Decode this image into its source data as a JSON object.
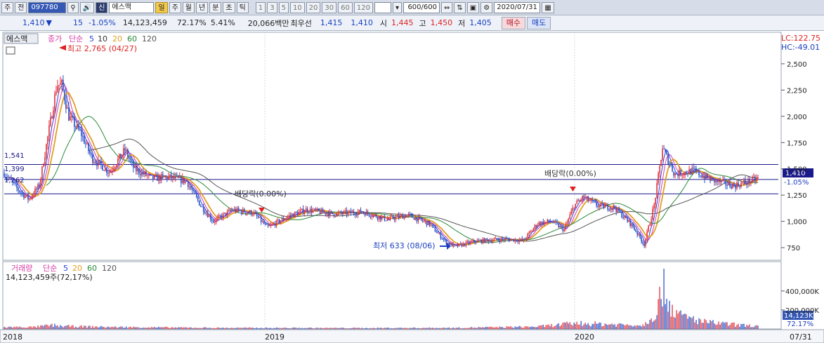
{
  "toolbar": {
    "market": "주",
    "prev": "전",
    "code": "097780",
    "search_icon": "search-icon",
    "speaker_icon": "speaker-icon",
    "name_badge": "신",
    "stock_name": "에스맥",
    "periods": [
      "일",
      "주",
      "월",
      "년",
      "분",
      "초",
      "틱"
    ],
    "active_period": "일",
    "intervals": [
      "1",
      "3",
      "5",
      "10",
      "20",
      "30",
      "60",
      "120"
    ],
    "count": "600",
    "count_total": "/600",
    "date": "2020/07/31"
  },
  "info": {
    "price": "1,410",
    "change_arrow": "▼",
    "change": "15",
    "change_pct": "-1.05%",
    "volume": "14,123,459",
    "volume_ratio": "72.17%",
    "turnover": "5.41%",
    "amount": "20,066백만",
    "bid_label": "최우선",
    "bid": "1,415",
    "ask": "1,410",
    "open_label": "시",
    "open": "1,445",
    "high_label": "고",
    "high": "1,450",
    "low_label": "저",
    "low": "1,405",
    "buy_label": "매수",
    "sell_label": "매도"
  },
  "price_panel": {
    "name": "에스맥",
    "legend": [
      "종가",
      "단순",
      "5",
      "10",
      "20",
      "60",
      "120"
    ],
    "lc": "LC:122.75",
    "hc": "HC:-49.01",
    "max_label": "최고 2,765 (04/27)",
    "min_label": "최저 633 (08/06)",
    "ex_div_1": "배당락(0.00%)",
    "ex_div_2": "배당락(0.00%)",
    "hline_labels": [
      "1,541",
      "1,399",
      "1,262"
    ],
    "last_price": "1,410",
    "last_pct": "-1.05%"
  },
  "volume_panel": {
    "legend": [
      "거래량",
      "단순",
      "5",
      "20",
      "60",
      "120"
    ],
    "current": "14,123,459주(72,17%)",
    "last_tag": "14,123K",
    "last_pct": "72.17%"
  },
  "x_axis": {
    "labels": [
      "2018",
      "2019",
      "2020",
      "07/31"
    ]
  },
  "colors": {
    "up": "#e0323c",
    "down": "#2c52c8",
    "ma5": "#2c3fd6",
    "ma10": "#d63ca6",
    "ma20": "#e0a020",
    "ma60": "#2a8a3a",
    "ma120": "#555555",
    "hline": "#1a1a8a"
  },
  "chart_data": {
    "type": "candlestick",
    "title": "에스맥",
    "x_range": [
      "2018-01",
      "2020-07-31"
    ],
    "price_ylim": [
      630,
      2800
    ],
    "price_ticks": [
      750,
      1000,
      1250,
      1500,
      1750,
      2000,
      2250,
      2500
    ],
    "price_tick_labels": [
      "750",
      "1,000",
      "1,250",
      "1,500",
      "1,750",
      "2,000",
      "2,250",
      "2,500"
    ],
    "volume_ylim": [
      0,
      480000
    ],
    "volume_ticks": [
      200000,
      400000
    ],
    "volume_tick_labels": [
      "200,000K",
      "400,000K"
    ],
    "close_series": [
      {
        "t": 0,
        "v": 1460
      },
      {
        "t": 20,
        "v": 1300
      },
      {
        "t": 35,
        "v": 1210
      },
      {
        "t": 50,
        "v": 1340
      },
      {
        "t": 62,
        "v": 1800
      },
      {
        "t": 75,
        "v": 2300
      },
      {
        "t": 82,
        "v": 2300
      },
      {
        "t": 92,
        "v": 2000
      },
      {
        "t": 110,
        "v": 1830
      },
      {
        "t": 125,
        "v": 1600
      },
      {
        "t": 150,
        "v": 1470
      },
      {
        "t": 172,
        "v": 1680
      },
      {
        "t": 185,
        "v": 1500
      },
      {
        "t": 210,
        "v": 1410
      },
      {
        "t": 235,
        "v": 1420
      },
      {
        "t": 260,
        "v": 1380
      },
      {
        "t": 280,
        "v": 1150
      },
      {
        "t": 298,
        "v": 1000
      },
      {
        "t": 325,
        "v": 1110
      },
      {
        "t": 355,
        "v": 1080
      },
      {
        "t": 375,
        "v": 940
      },
      {
        "t": 405,
        "v": 1050
      },
      {
        "t": 430,
        "v": 1110
      },
      {
        "t": 470,
        "v": 1070
      },
      {
        "t": 510,
        "v": 1090
      },
      {
        "t": 545,
        "v": 1020
      },
      {
        "t": 575,
        "v": 1060
      },
      {
        "t": 605,
        "v": 980
      },
      {
        "t": 630,
        "v": 800
      },
      {
        "t": 642,
        "v": 760
      },
      {
        "t": 670,
        "v": 810
      },
      {
        "t": 710,
        "v": 830
      },
      {
        "t": 740,
        "v": 820
      },
      {
        "t": 760,
        "v": 980
      },
      {
        "t": 780,
        "v": 1000
      },
      {
        "t": 798,
        "v": 920
      },
      {
        "t": 812,
        "v": 1150
      },
      {
        "t": 825,
        "v": 1230
      },
      {
        "t": 845,
        "v": 1150
      },
      {
        "t": 870,
        "v": 1130
      },
      {
        "t": 895,
        "v": 960
      },
      {
        "t": 912,
        "v": 780
      },
      {
        "t": 926,
        "v": 1150
      },
      {
        "t": 938,
        "v": 1700
      },
      {
        "t": 955,
        "v": 1450
      },
      {
        "t": 980,
        "v": 1480
      },
      {
        "t": 1010,
        "v": 1390
      },
      {
        "t": 1040,
        "v": 1340
      },
      {
        "t": 1075,
        "v": 1410
      }
    ],
    "volume_series": [
      {
        "t": 40,
        "v": 20000
      },
      {
        "t": 70,
        "v": 40000
      },
      {
        "t": 80,
        "v": 30000
      },
      {
        "t": 160,
        "v": 20000
      },
      {
        "t": 300,
        "v": 12000
      },
      {
        "t": 500,
        "v": 10000
      },
      {
        "t": 640,
        "v": 12000
      },
      {
        "t": 760,
        "v": 25000
      },
      {
        "t": 815,
        "v": 60000
      },
      {
        "t": 910,
        "v": 40000
      },
      {
        "t": 930,
        "v": 180000
      },
      {
        "t": 938,
        "v": 460000
      },
      {
        "t": 950,
        "v": 240000
      },
      {
        "t": 962,
        "v": 140000
      },
      {
        "t": 1000,
        "v": 70000
      },
      {
        "t": 1050,
        "v": 40000
      },
      {
        "t": 1075,
        "v": 30000
      }
    ]
  }
}
